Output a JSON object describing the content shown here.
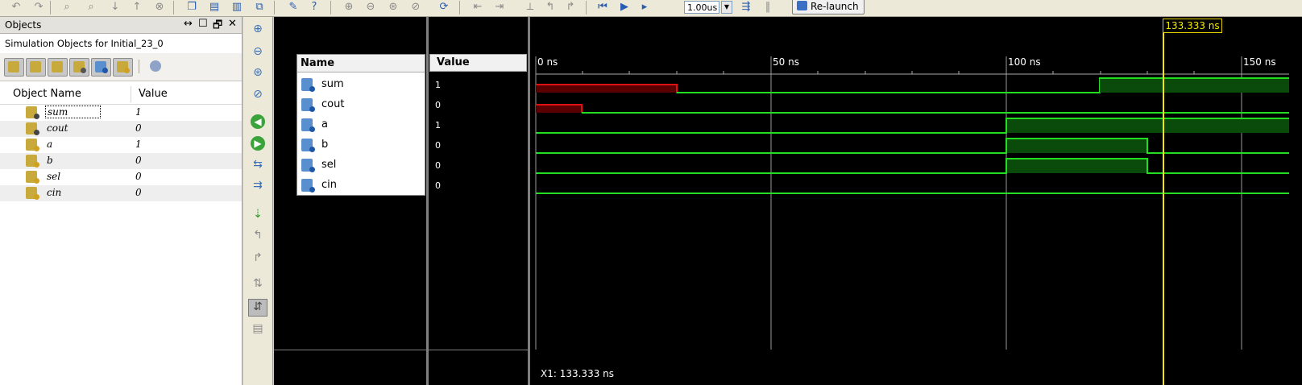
{
  "toolbar": {
    "zoom_value": "1.00us",
    "relaunch_label": "Re-launch"
  },
  "objects_panel": {
    "title": "Objects",
    "window_controls": [
      "↔",
      "☐",
      "🗗",
      "✕"
    ],
    "subtitle": "Simulation Objects for Initial_23_0",
    "columns": {
      "name": "Object Name",
      "value": "Value"
    },
    "rows": [
      {
        "name": "sum",
        "value": "1"
      },
      {
        "name": "cout",
        "value": "0"
      },
      {
        "name": "a",
        "value": "1"
      },
      {
        "name": "b",
        "value": "0"
      },
      {
        "name": "sel",
        "value": "0"
      },
      {
        "name": "cin",
        "value": "0"
      }
    ]
  },
  "wave": {
    "name_header": "Name",
    "value_header": "Value",
    "signals": [
      {
        "name": "sum",
        "value": "1"
      },
      {
        "name": "cout",
        "value": "0"
      },
      {
        "name": "a",
        "value": "1"
      },
      {
        "name": "b",
        "value": "0"
      },
      {
        "name": "sel",
        "value": "0"
      },
      {
        "name": "cin",
        "value": "0"
      }
    ],
    "time_labels": [
      "0 ns",
      "50 ns",
      "100 ns",
      "150 ns"
    ],
    "cursor_label": "133.333 ns",
    "x1_readout": "X1: 133.333 ns",
    "colors": {
      "high": "#22dd22",
      "x_state": "#dd1111",
      "cursor": "#f4e800",
      "background": "#000000"
    }
  }
}
